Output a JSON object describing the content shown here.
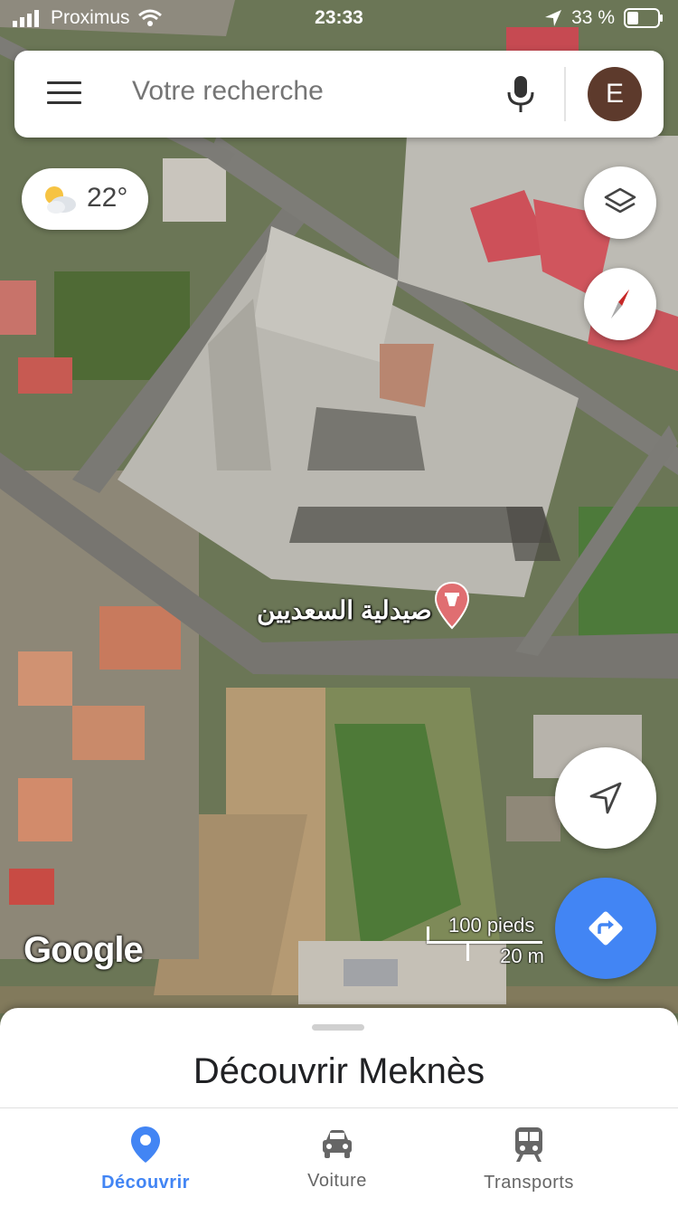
{
  "status_bar": {
    "carrier": "Proximus",
    "time": "23:33",
    "battery": "33 %"
  },
  "search": {
    "placeholder": "Votre recherche",
    "avatar_letter": "E"
  },
  "weather": {
    "temperature": "22°",
    "icon": "partly-cloudy-icon"
  },
  "map": {
    "poi_label": "صيدلية السعديين",
    "attribution": "Google",
    "scale": {
      "imperial": "100 pieds",
      "metric": "20 m"
    }
  },
  "sheet": {
    "title": "Découvrir Meknès"
  },
  "bottom_nav": [
    {
      "label": "Découvrir",
      "icon": "location-pin-icon",
      "active": true
    },
    {
      "label": "Voiture",
      "icon": "car-icon",
      "active": false
    },
    {
      "label": "Transports",
      "icon": "train-icon",
      "active": false
    }
  ],
  "colors": {
    "accent": "#4285f4",
    "inactive": "#666666",
    "poi": "#e57373",
    "avatar": "#5d3a2c"
  }
}
